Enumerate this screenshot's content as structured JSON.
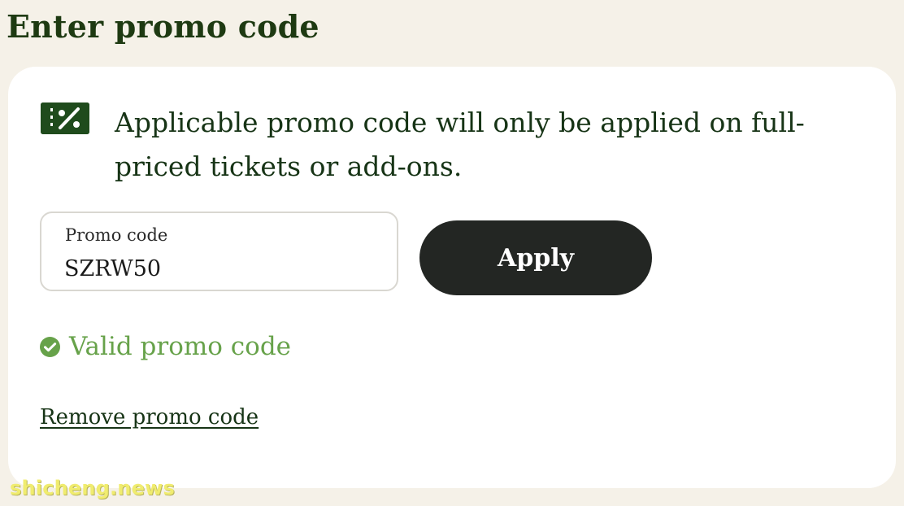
{
  "page": {
    "title": "Enter promo code"
  },
  "card": {
    "notice": "Applicable promo code will only be applied on full-priced tickets or add-ons.",
    "icon": "promo-ticket-icon"
  },
  "promo_form": {
    "label": "Promo code",
    "value": "SZRW50",
    "apply_label": "Apply"
  },
  "status": {
    "text": "Valid promo code",
    "icon": "check-circle-icon",
    "color": "#67a24a"
  },
  "actions": {
    "remove_label": "Remove promo code"
  },
  "watermark": {
    "text": "shicheng.news"
  },
  "colors": {
    "background": "#f5f1e8",
    "card": "#ffffff",
    "text": "#173416",
    "accent": "#1f4b1c",
    "button": "#232623"
  }
}
